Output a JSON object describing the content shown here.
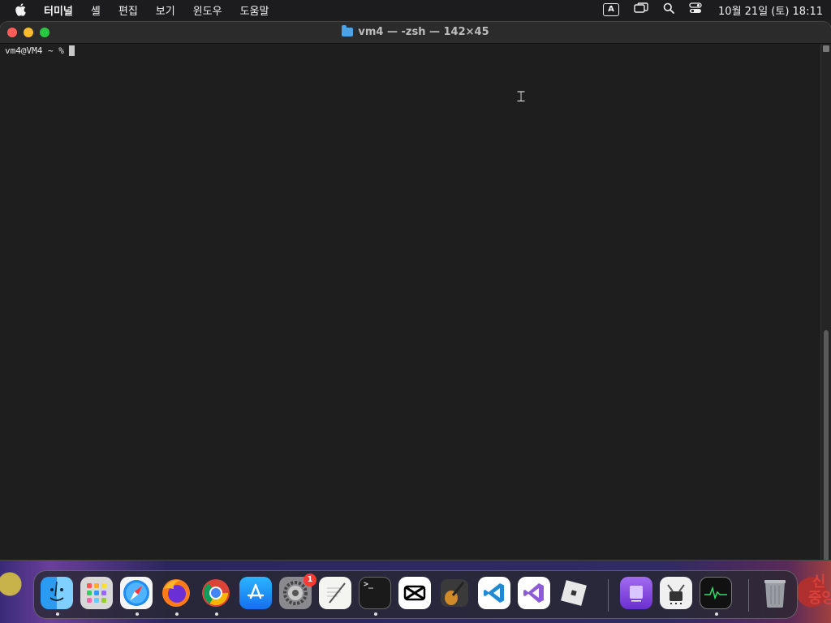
{
  "menubar": {
    "app_name": "터미널",
    "menus": [
      "셸",
      "편집",
      "보기",
      "윈도우",
      "도움말"
    ],
    "input_indicator": "A",
    "clock": "10월 21일 (토) 18:11"
  },
  "window": {
    "title": "vm4 — -zsh — 142×45",
    "prompt": "vm4@VM4 ~ %"
  },
  "dock": {
    "settings_badge": "1",
    "apps": [
      "Finder",
      "Launchpad",
      "Safari",
      "Firefox",
      "Chrome",
      "App Store",
      "System Settings",
      "TextEdit",
      "Terminal",
      "CapCut",
      "Instruments",
      "VS Code",
      "Visual Studio",
      "Roblox Studio",
      "Apple Configurator",
      "Mac Configurator",
      "Activity Monitor",
      "Trash"
    ]
  },
  "wallpaper_text": "신\n중앙",
  "colors": {
    "terminal_bg": "#1e1e1e",
    "menubar_bg": "#1c1c1e",
    "close": "#ff5f57",
    "minimize": "#febc2e",
    "maximize": "#28c840"
  }
}
